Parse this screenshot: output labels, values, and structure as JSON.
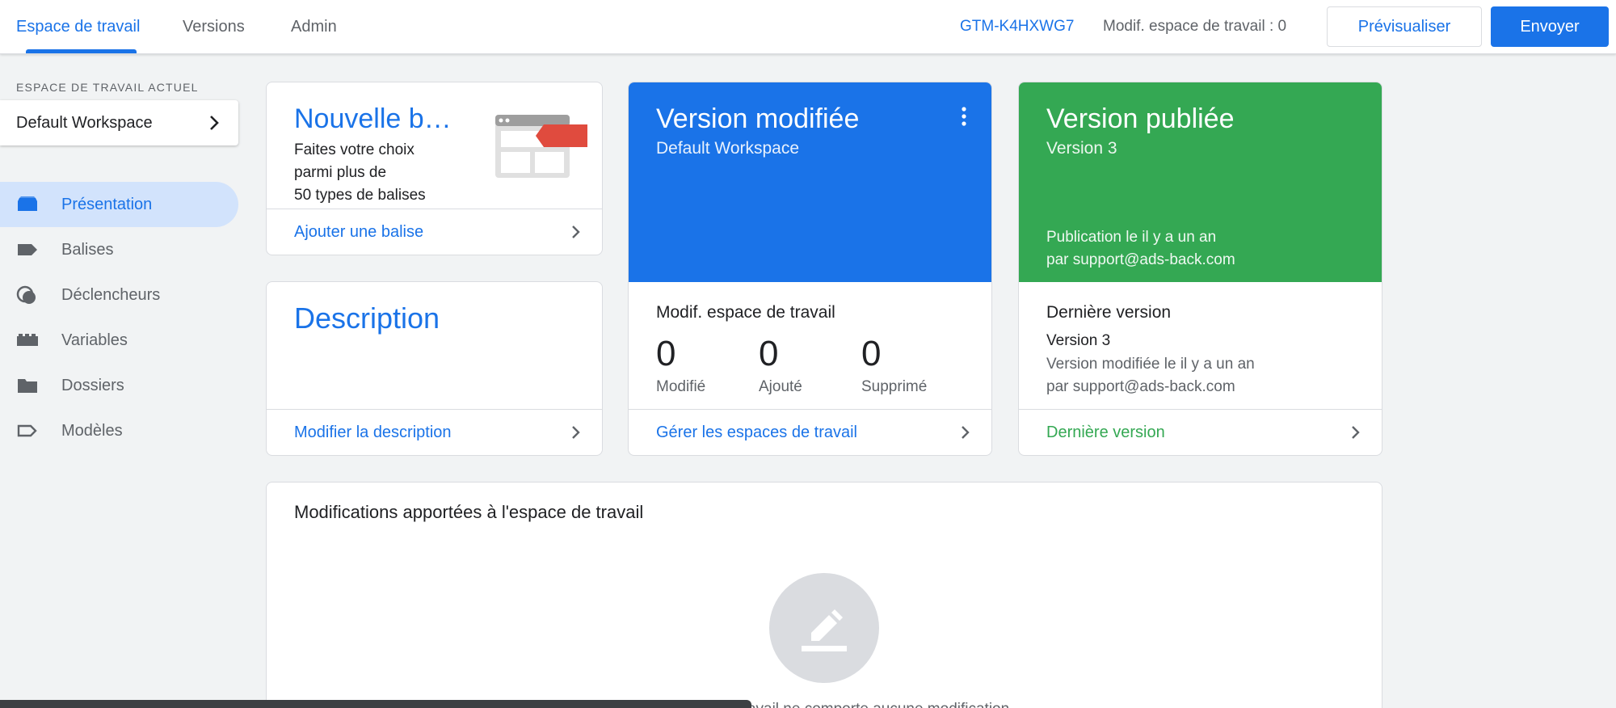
{
  "topbar": {
    "tabs": [
      "Espace de travail",
      "Versions",
      "Admin"
    ],
    "active_tab": "Espace de travail",
    "container_id": "GTM-K4HXWG7",
    "workspace_changes": "Modif. espace de travail : 0",
    "preview_label": "Prévisualiser",
    "submit_label": "Envoyer"
  },
  "sidebar": {
    "heading": "ESPACE DE TRAVAIL ACTUEL",
    "workspace_name": "Default Workspace",
    "items": [
      {
        "label": "Présentation",
        "icon": "overview-icon",
        "active": true
      },
      {
        "label": "Balises",
        "icon": "tag-icon"
      },
      {
        "label": "Déclencheurs",
        "icon": "trigger-icon"
      },
      {
        "label": "Variables",
        "icon": "variables-icon"
      },
      {
        "label": "Dossiers",
        "icon": "folder-icon"
      },
      {
        "label": "Modèles",
        "icon": "template-icon"
      }
    ]
  },
  "new_tag_card": {
    "title": "Nouvelle balise",
    "description_lines": [
      "Faites votre choix",
      "parmi plus de",
      "50 types de balises"
    ],
    "link": "Ajouter une balise"
  },
  "description_card": {
    "title": "Description",
    "link": "Modifier la description"
  },
  "modified_version_card": {
    "title": "Version modifiée",
    "subtitle": "Default Workspace",
    "stats_title": "Modif. espace de travail",
    "stats": [
      {
        "value": "0",
        "label": "Modifié"
      },
      {
        "value": "0",
        "label": "Ajouté"
      },
      {
        "value": "0",
        "label": "Supprimé"
      }
    ],
    "link": "Gérer les espaces de travail",
    "color": "#1a73e8"
  },
  "published_version_card": {
    "title": "Version publiée",
    "subtitle": "Version 3",
    "published_line1": "Publication le il y a un an",
    "published_line2": "par support@ads-back.com",
    "latest_title": "Dernière version",
    "latest_version": "Version 3",
    "latest_line1": "Version modifiée le il y a un an",
    "latest_line2": "par support@ads-back.com",
    "link": "Dernière version",
    "color": "#34a853"
  },
  "changes_card": {
    "title": "Modifications apportées à l'espace de travail",
    "empty_text": "Cet espace de travail ne comporte aucune modification."
  }
}
